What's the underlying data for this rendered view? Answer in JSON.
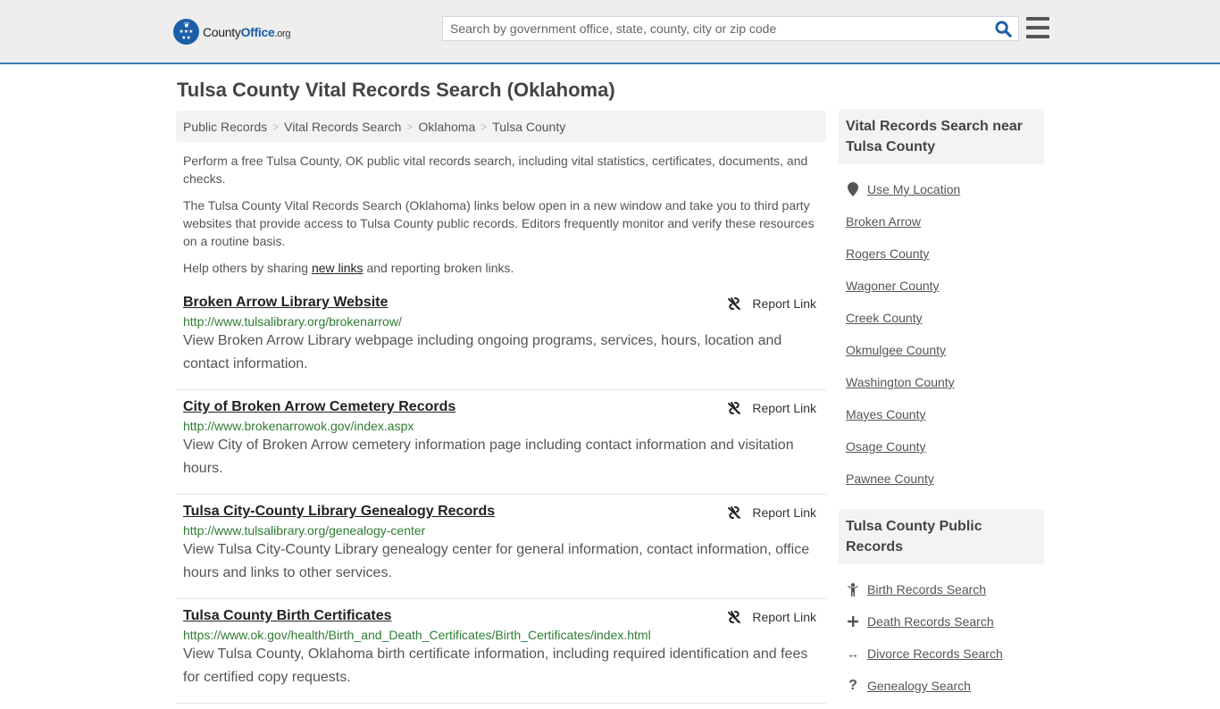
{
  "header": {
    "logo": {
      "brand_county": "County",
      "brand_office": "Office",
      "brand_tld": ".org",
      "icon": "eagle-stars-badge"
    },
    "search": {
      "placeholder": "Search by government office, state, county, city or zip code",
      "value": "",
      "icon": "search-icon"
    },
    "menu_icon": "hamburger-menu-icon",
    "accent_color": "#1b5fa6",
    "border_color": "#3a7cad"
  },
  "page": {
    "title": "Tulsa County Vital Records Search (Oklahoma)",
    "breadcrumb": [
      {
        "label": "Public Records"
      },
      {
        "label": "Vital Records Search"
      },
      {
        "label": "Oklahoma"
      },
      {
        "label": "Tulsa County"
      }
    ],
    "breadcrumb_separator": ">",
    "intro": {
      "p1": "Perform a free Tulsa County, OK public vital records search, including vital statistics, certificates, documents, and checks.",
      "p2": "The Tulsa County Vital Records Search (Oklahoma) links below open in a new window and take you to third party websites that provide access to Tulsa County public records. Editors frequently monitor and verify these resources on a routine basis.",
      "p3_before": "Help others by sharing ",
      "p3_link": "new links",
      "p3_after": " and reporting broken links."
    }
  },
  "results": [
    {
      "title": "Broken Arrow Library Website",
      "url": "http://www.tulsalibrary.org/brokenarrow/",
      "description": "View Broken Arrow Library webpage including ongoing programs, services, hours, location and contact information.",
      "report_label": "Report Link"
    },
    {
      "title": "City of Broken Arrow Cemetery Records",
      "url": "http://www.brokenarrowok.gov/index.aspx",
      "description": "View City of Broken Arrow cemetery information page including contact information and visitation hours.",
      "report_label": "Report Link"
    },
    {
      "title": "Tulsa City-County Library Genealogy Records",
      "url": "http://www.tulsalibrary.org/genealogy-center",
      "description": "View Tulsa City-County Library genealogy center for general information, contact information, office hours and links to other services.",
      "report_label": "Report Link"
    },
    {
      "title": "Tulsa County Birth Certificates",
      "url": "https://www.ok.gov/health/Birth_and_Death_Certificates/Birth_Certificates/index.html",
      "description": "View Tulsa County, Oklahoma birth certificate information, including required identification and fees for certified copy requests.",
      "report_label": "Report Link"
    }
  ],
  "sidebar": {
    "nearby": {
      "heading": "Vital Records Search near Tulsa County",
      "use_location": {
        "label": "Use My Location",
        "icon": "map-pin-icon"
      },
      "items": [
        {
          "label": "Broken Arrow"
        },
        {
          "label": "Rogers County"
        },
        {
          "label": "Wagoner County"
        },
        {
          "label": "Creek County"
        },
        {
          "label": "Okmulgee County"
        },
        {
          "label": "Washington County"
        },
        {
          "label": "Mayes County"
        },
        {
          "label": "Osage County"
        },
        {
          "label": "Pawnee County"
        }
      ]
    },
    "public_records": {
      "heading": "Tulsa County Public Records",
      "items": [
        {
          "label": "Birth Records Search",
          "icon": "child-icon",
          "glyph": "🯅"
        },
        {
          "label": "Death Records Search",
          "icon": "cross-icon",
          "glyph": "+"
        },
        {
          "label": "Divorce Records Search",
          "icon": "arrows-horizontal-icon",
          "glyph": "↔"
        },
        {
          "label": "Genealogy Search",
          "icon": "question-icon",
          "glyph": "?"
        }
      ]
    }
  }
}
